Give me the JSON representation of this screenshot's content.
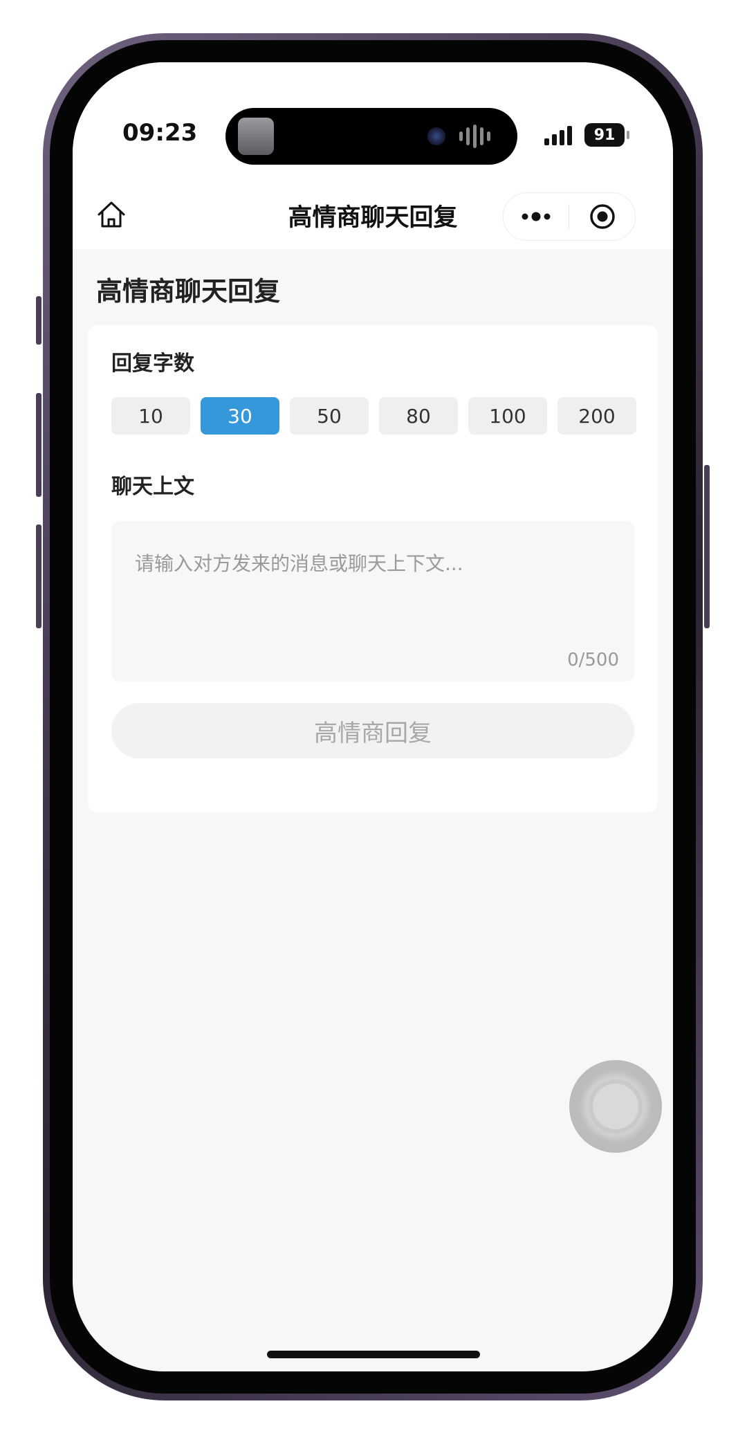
{
  "status_bar": {
    "time": "09:23",
    "battery": "91"
  },
  "navbar": {
    "title": "高情商聊天回复",
    "home_icon": "home-icon",
    "more_icon": "more-dots-icon",
    "close_icon": "target-circle-icon"
  },
  "page": {
    "heading": "高情商聊天回复"
  },
  "form": {
    "word_count_label": "回复字数",
    "word_count_options": [
      "10",
      "30",
      "50",
      "80",
      "100",
      "200"
    ],
    "selected_word_count": "30",
    "context_label": "聊天上文",
    "context_placeholder": "请输入对方发来的消息或聊天上下文...",
    "context_value": "",
    "char_counter": "0/500",
    "submit_label": "高情商回复",
    "submit_enabled": false
  },
  "colors": {
    "accent": "#3498db",
    "page_bg": "#f7f7f7",
    "card_bg": "#ffffff"
  }
}
